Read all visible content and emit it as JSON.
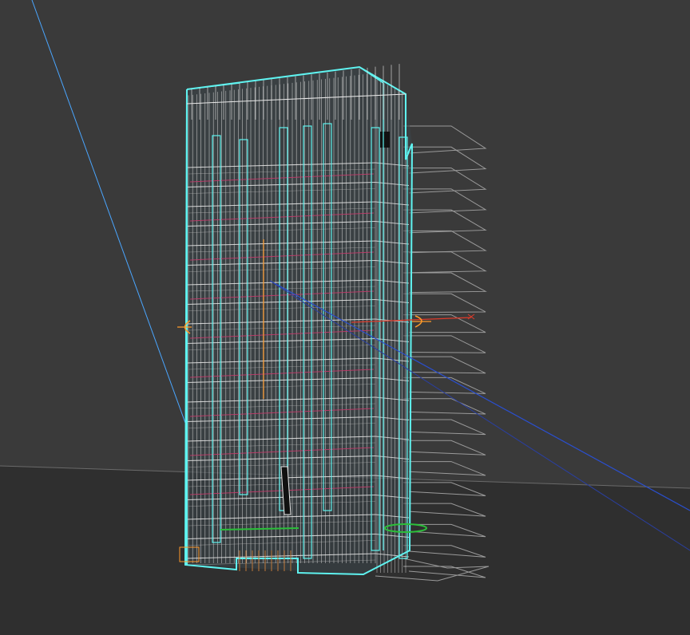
{
  "viewport": {
    "background_upper": "#3a3a3a",
    "background_lower": "#2f2f2f",
    "view_mode": "wireframe"
  },
  "colors": {
    "selection_cyan": "#5ff3f0",
    "wire_white": "#e8e8e8",
    "wire_grey": "#bdbdbd",
    "edge_pink": "#c23a6a",
    "gizmo_red": "#e03a2a",
    "gizmo_green": "#2bbf3a",
    "gizmo_blue": "#2a4fd0",
    "gizmo_orange": "#ff9a2a",
    "camera_line_blue": "#4aa6ff",
    "ground_grey": "#9a9a9a"
  },
  "scene_objects": [
    {
      "name": "tower-building",
      "state": "selected"
    },
    {
      "name": "floor-slab-planes",
      "count": 22
    },
    {
      "name": "ground-plane"
    },
    {
      "name": "camera-line"
    },
    {
      "name": "transform-gizmo"
    }
  ]
}
